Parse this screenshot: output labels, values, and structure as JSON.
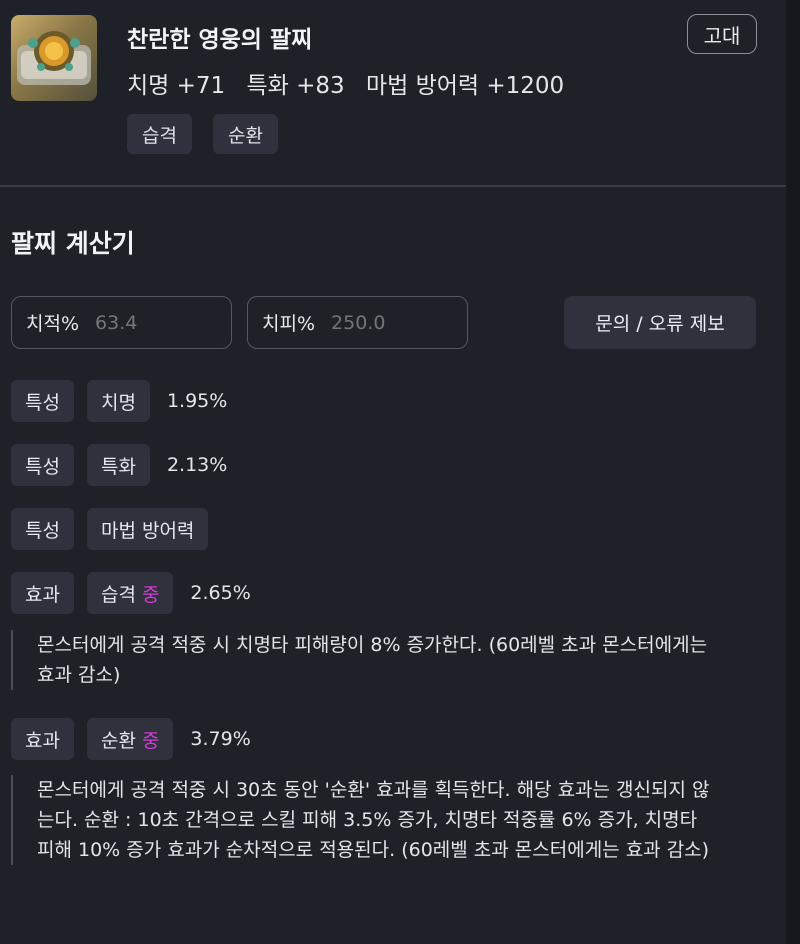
{
  "item": {
    "name": "찬란한 영웅의 팔찌",
    "grade": "고대",
    "stats": [
      "치명 +71",
      "특화 +83",
      "마법 방어력 +1200"
    ],
    "tags": [
      "습격",
      "순환"
    ]
  },
  "calculator": {
    "title": "팔찌 계산기",
    "crit_rate_label": "치적%",
    "crit_rate_value": "63.4",
    "crit_dmg_label": "치피%",
    "crit_dmg_value": "250.0",
    "report_button": "문의 / 오류 제보"
  },
  "rows": [
    {
      "kind": "특성",
      "name": "치명",
      "value": "1.95%"
    },
    {
      "kind": "특성",
      "name": "특화",
      "value": "2.13%"
    },
    {
      "kind": "특성",
      "name": "마법 방어력",
      "value": ""
    },
    {
      "kind": "효과",
      "name": "습격",
      "grade": "중",
      "value": "2.65%",
      "description": "몬스터에게 공격 적중 시 치명타 피해량이 8% 증가한다. (60레벨 초과 몬스터에게는 효과 감소)"
    },
    {
      "kind": "효과",
      "name": "순환",
      "grade": "중",
      "value": "3.79%",
      "description": "몬스터에게 공격 적중 시 30초 동안 '순환' 효과를 획득한다. 해당 효과는 갱신되지 않는다. 순환 : 10초 간격으로 스킬 피해 3.5% 증가, 치명타 적중률 6% 증가, 치명타 피해 10% 증가 효과가 순차적으로 적용된다. (60레벨 초과 몬스터에게는 효과 감소)"
    }
  ],
  "colors": {
    "accent_grade": "#d63bd6",
    "background": "#1f2128",
    "chip": "#2f323c"
  }
}
